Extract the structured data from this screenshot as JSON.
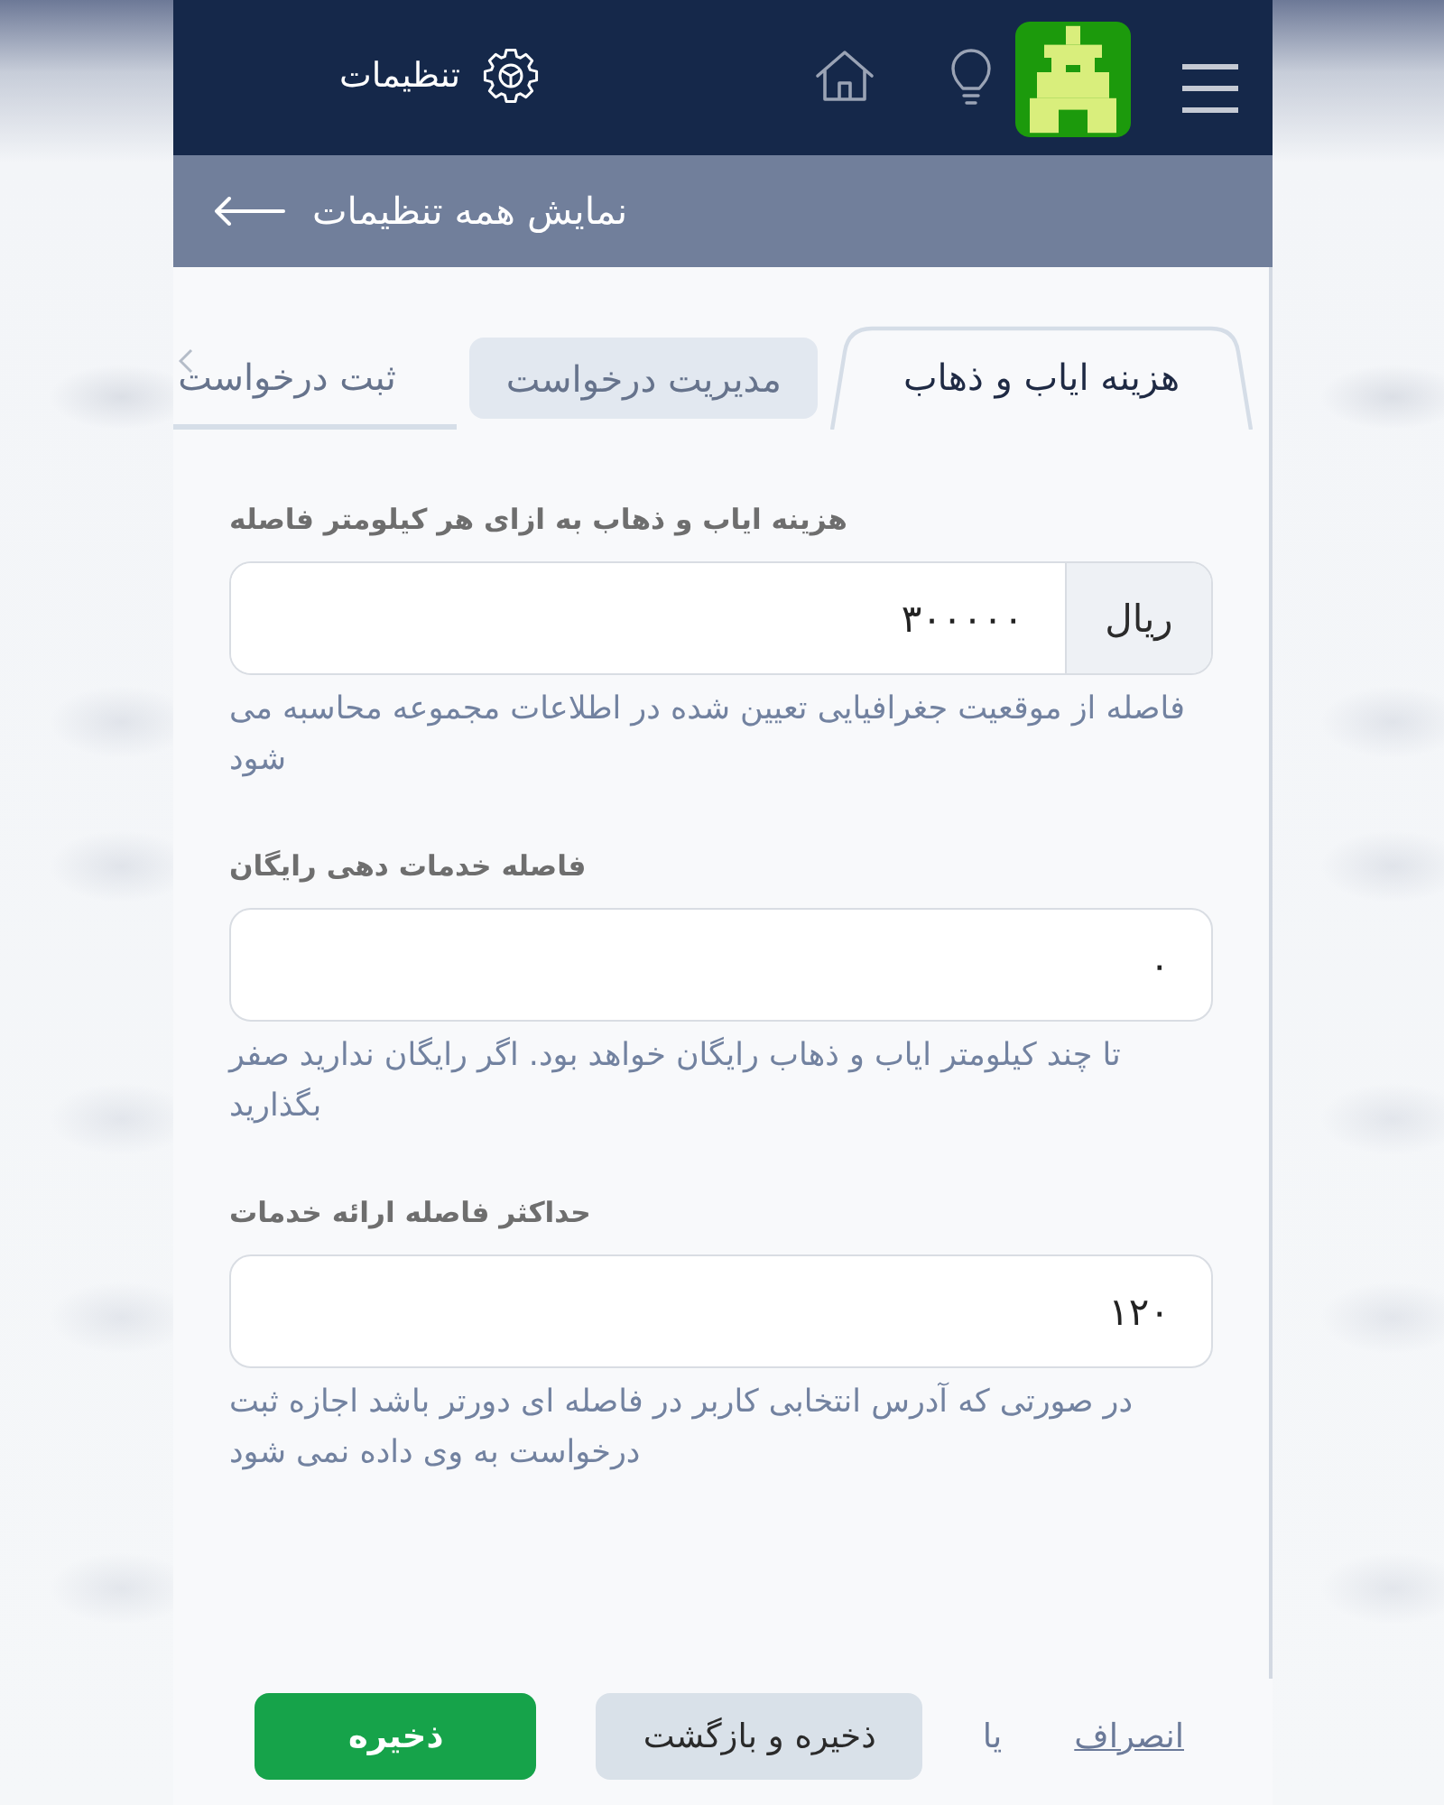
{
  "header": {
    "title": "تنظیمات"
  },
  "subheader": {
    "link": "نمایش همه تنظیمات"
  },
  "tabs": [
    {
      "label": "هزینه ایاب و ذهاب",
      "selected": true,
      "highlighted": false
    },
    {
      "label": "مدیریت درخواست",
      "selected": false,
      "highlighted": true
    },
    {
      "label": "ثبت درخواست",
      "selected": false,
      "highlighted": false
    }
  ],
  "fields": [
    {
      "label": "هزینه ایاب و ذهاب به ازای هر کیلومتر فاصله",
      "value": "۳۰۰۰۰۰",
      "addon": "ریال",
      "help": "فاصله از موقعیت جغرافیایی تعیین شده در اطلاعات مجموعه محاسبه می شود"
    },
    {
      "label": "فاصله خدمات دهی رایگان",
      "value": "۰",
      "help": "تا چند کیلومتر ایاب و ذهاب رایگان خواهد بود. اگر رایگان ندارید صفر بگذارید"
    },
    {
      "label": "حداکثر فاصله ارائه خدمات",
      "value": "۱۲۰",
      "help": "در صورتی که آدرس انتخابی کاربر در فاصله ای دورتر باشد اجازه ثبت درخواست به وی داده نمی شود"
    }
  ],
  "footer": {
    "cancel": "انصراف",
    "separator": "یا",
    "buttons": [
      {
        "label": "ذخیره و بازگشت",
        "kind": "secondary"
      },
      {
        "label": "ذخیره",
        "kind": "primary"
      }
    ]
  }
}
